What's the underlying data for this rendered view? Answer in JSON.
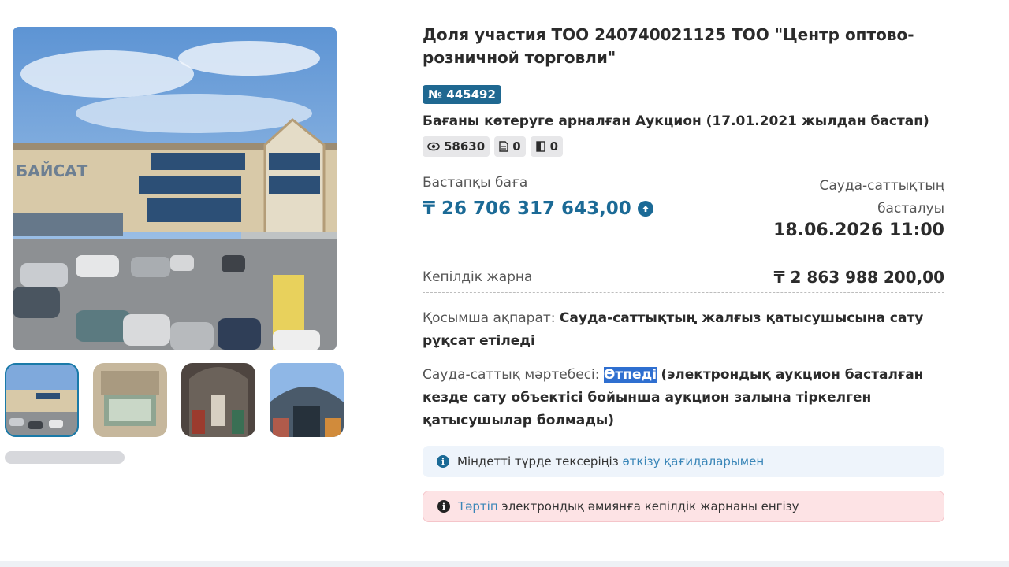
{
  "lot": {
    "title": "Доля участия ТОО 240740021125 ТОО \"Центр оптово-розничной торговли\"",
    "number": "№ 445492",
    "auction_type": "Бағаны көтеруге арналған Аукцион (17.01.2021 жылдан бастап)",
    "stats": {
      "views": "58630",
      "documents": "0",
      "bids": "0"
    }
  },
  "price": {
    "label": "Бастапқы баға",
    "value": "₸ 26 706 317 643,00",
    "start_label": "Сауда-саттықтың басталуы",
    "start_date": "18.06.2026 11:00"
  },
  "deposit": {
    "label": "Кепілдік жарна",
    "value": "₸ 2 863 988 200,00"
  },
  "extra": {
    "label": "Қосымша ақпарат:",
    "text": "Сауда-саттықтың жалғыз қатысушысына сату рұқсат етіледі"
  },
  "status": {
    "label": "Сауда-саттық мәртебесі:",
    "value": "Өтпеді",
    "note": "(электрондық аукцион басталған кезде сату объектісі бойынша аукцион залына тіркелген қатысушылар болмады)"
  },
  "notices": {
    "info_text": "Міндетті түрде тексеріңіз",
    "info_link": "өткізу қағидаларымен",
    "warn_link": "Тәртіп",
    "warn_text": "электрондық әмиянға кепілдік жарнаны енгізу"
  },
  "photo": {
    "sign": "БАЙСАТ"
  },
  "colors": {
    "accent": "#1b6a96",
    "badge": "#1f6891",
    "highlight": "#2f6fd0",
    "warn_bg": "#fde3e5",
    "info_bg": "#eef4fb"
  }
}
